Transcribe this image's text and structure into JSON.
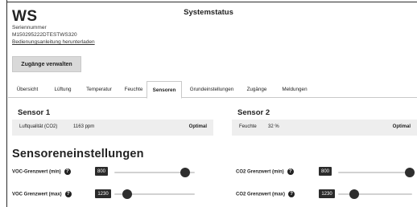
{
  "header": {
    "device_name": "WS",
    "page_title": "Systemstatus",
    "serial_label": "Seriennummer",
    "serial_value": "M150295222DTESTWS320",
    "manual_link": "Bedienungsanleitung herunterladen"
  },
  "actions": {
    "access_button": "Zugänge verwalten"
  },
  "tabs": [
    {
      "label": "Übersicht",
      "active": false
    },
    {
      "label": "Lüftung",
      "active": false
    },
    {
      "label": "Temperatur",
      "active": false
    },
    {
      "label": "Feuchte",
      "active": false
    },
    {
      "label": "Sensoren",
      "active": true
    },
    {
      "label": "Grundeinstellungen",
      "active": false
    },
    {
      "label": "Zugänge",
      "active": false
    },
    {
      "label": "Meldungen",
      "active": false
    }
  ],
  "sensors": [
    {
      "title": "Sensor 1",
      "measure": "Luftqualität (CO2)",
      "value": "1163 ppm",
      "status": "Optimal"
    },
    {
      "title": "Sensor 2",
      "measure": "Feuchte",
      "value": "32 %",
      "status": "Optimal"
    }
  ],
  "settings": {
    "title": "Sensoreneinstellungen",
    "items": [
      {
        "label": "VOC-Grenzwert (min)",
        "value": "800",
        "level": 0.88
      },
      {
        "label": "VOC Grenzwert (max)",
        "value": "1230",
        "level": 0.16
      },
      {
        "label": "CO2 Grenzwert (min)",
        "value": "800",
        "level": 0.97
      },
      {
        "label": "CO2 Grenzwert (max)",
        "value": "1230",
        "level": 0.22
      }
    ],
    "help_icon": "?"
  },
  "colors": {
    "dark": "#2b2b2b",
    "panel": "#eeeeee",
    "button": "#d9d9d9"
  }
}
